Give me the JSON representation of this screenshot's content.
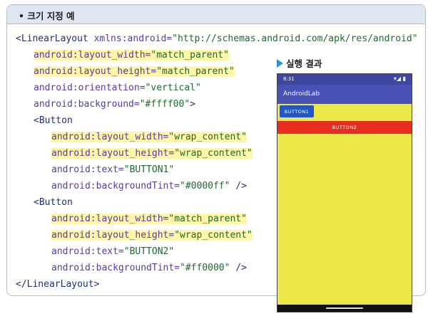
{
  "header": {
    "title": "• 크기 지정 예"
  },
  "code": {
    "l1_tag": "<LinearLayout ",
    "l1_attr": "xmlns:android=",
    "l1_val": "\"http://schemas.android.com/apk/res/android\"",
    "l2_attr": "android:layout_width=",
    "l2_val": "\"match_parent\"",
    "l3_attr": "android:layout_height=",
    "l3_val": "\"match_parent\"",
    "l4_attr": "android:orientation=",
    "l4_val": "\"vertical\"",
    "l5_attr": "android:background=",
    "l5_val": "\"#ffff00\"",
    "l5_end": ">",
    "l6_tag": "<Button",
    "l7_attr": "android:layout_width=",
    "l7_val": "\"wrap_content\"",
    "l8_attr": "android:layout_height=",
    "l8_val": "\"wrap_content\"",
    "l9_attr": "android:text=",
    "l9_val": "\"BUTTON1\"",
    "l10_attr": "android:backgroundTint=",
    "l10_val": "\"#0000ff\"",
    "l10_end": " />",
    "l11_tag": "<Button",
    "l12_attr": "android:layout_width=",
    "l12_val": "\"match_parent\"",
    "l13_attr": "android:layout_height=",
    "l13_val": "\"wrap_content\"",
    "l14_attr": "android:text=",
    "l14_val": "\"BUTTON2\"",
    "l15_attr": "android:backgroundTint=",
    "l15_val": "\"#ff0000\"",
    "l15_end": " />",
    "l16_tag": "</LinearLayout>"
  },
  "result": {
    "label": "실행 결과"
  },
  "phone": {
    "time": "8:31",
    "status_icons": "▾◢ ▮",
    "app_title": "AndroidLab",
    "button1": "BUTTON1",
    "button2": "BUTTON2",
    "colors": {
      "background": "#ede84a",
      "appbar": "#4752b4",
      "button1": "#2556c5",
      "button2": "#ea2d21"
    }
  }
}
